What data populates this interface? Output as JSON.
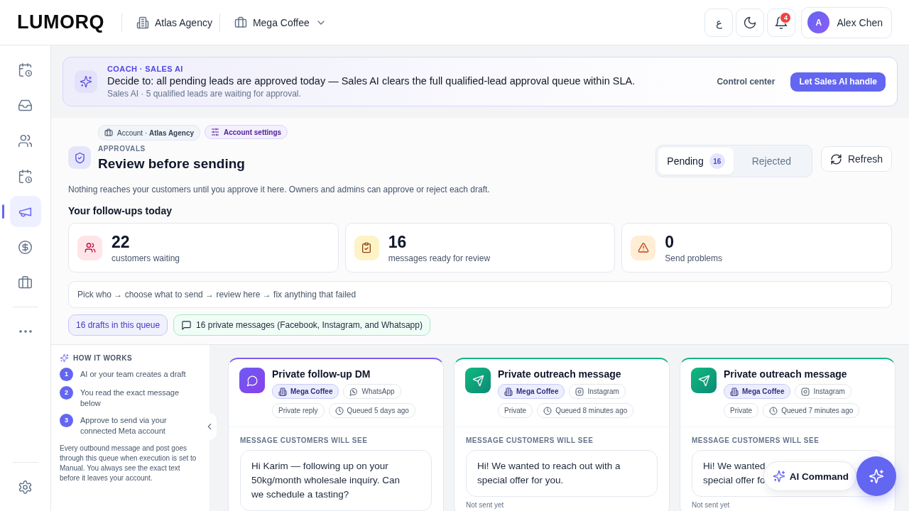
{
  "header": {
    "logo": "LUMORQ",
    "agency": "Atlas Agency",
    "brand": "Mega Coffee",
    "language_button": "ع",
    "notification_count": "4",
    "user": {
      "initial": "A",
      "name": "Alex Chen"
    }
  },
  "sidebar": {
    "items": [
      {
        "kind": "calendar",
        "selected": false
      },
      {
        "kind": "inbox",
        "selected": false
      },
      {
        "kind": "users",
        "selected": false
      },
      {
        "kind": "calendar",
        "selected": false
      },
      {
        "kind": "megaphone",
        "selected": true
      },
      {
        "kind": "dollar",
        "selected": false
      },
      {
        "kind": "briefcase",
        "selected": false
      }
    ]
  },
  "coach": {
    "label": "COACH · SALES AI",
    "message": "Decide to: all pending leads are approved today — Sales AI clears the full qualified-lead approval queue within SLA.",
    "detail": "Sales AI · 5 qualified leads are waiting for approval.",
    "link": "Control center",
    "action": "Let Sales AI handle"
  },
  "approvals": {
    "account_chip": "Account · **Atlas Agency**",
    "settings_chip": "Account settings",
    "eyebrow": "APPROVALS",
    "title": "Review before sending",
    "description": "Nothing reaches your customers until you approve it here. Owners and admins can approve or reject each draft.",
    "tabs": [
      {
        "label": "Pending",
        "count": "16",
        "selected": true
      },
      {
        "label": "Rejected",
        "selected": false
      }
    ],
    "refresh": "Refresh",
    "followups_title": "Your follow-ups today",
    "stats": [
      {
        "kind": "customers",
        "value": "22",
        "label": "customers waiting"
      },
      {
        "kind": "review",
        "value": "16",
        "label": "messages ready for review"
      },
      {
        "kind": "problems",
        "value": "0",
        "label": "Send problems"
      }
    ],
    "flow": "Pick who → choose what to send → review here → fix anything that failed",
    "badges": [
      {
        "kind": "drafts",
        "text": "16 drafts in this queue"
      },
      {
        "kind": "messages",
        "text": "16 private messages (Facebook, Instagram, and Whatsapp)"
      }
    ]
  },
  "how_it_works": {
    "title": "HOW IT WORKS",
    "steps": [
      {
        "number": "1",
        "text": "AI or your team creates a draft"
      },
      {
        "number": "2",
        "text": "You read the exact message below"
      },
      {
        "number": "3",
        "text": "Approve to send via your connected Meta account"
      }
    ],
    "note": "Every outbound message and post goes through this queue when execution is set to Manual. You always see the exact text before it leaves your account."
  },
  "cards": [
    {
      "kind": "chat",
      "color": "#7c5cf0",
      "title": "Private follow-up DM",
      "account": "Mega Coffee",
      "channel": {
        "kind": "whatsapp",
        "label": "WhatsApp"
      },
      "type": "Private reply",
      "queued": "Queued 5 days ago",
      "section_label": "MESSAGE CUSTOMERS WILL SEE",
      "message_lines": [
        "Hi Karim — following up on your",
        "50kg/month wholesale inquiry. Can",
        "we schedule a tasting?"
      ]
    },
    {
      "kind": "send",
      "color": "#10b981",
      "title": "Private outreach message",
      "account": "Mega Coffee",
      "channel": {
        "kind": "instagram",
        "label": "Instagram"
      },
      "type": "Private",
      "queued": "Queued 8 minutes ago",
      "section_label": "MESSAGE CUSTOMERS WILL SEE",
      "message_lines": [
        "Hi! We wanted to reach out with a",
        "special offer for you."
      ],
      "status": "Not sent yet"
    },
    {
      "kind": "send",
      "color": "#10b981",
      "title": "Private outreach message",
      "account": "Mega Coffee",
      "channel": {
        "kind": "instagram",
        "label": "Instagram"
      },
      "type": "Private",
      "queued": "Queued 7 minutes ago",
      "section_label": "MESSAGE CUSTOMERS WILL SEE",
      "message_lines": [
        "Hi! We wanted",
        "special offer fo"
      ],
      "status": "Not sent yet"
    }
  ],
  "ai_command": {
    "label": "AI Command"
  }
}
